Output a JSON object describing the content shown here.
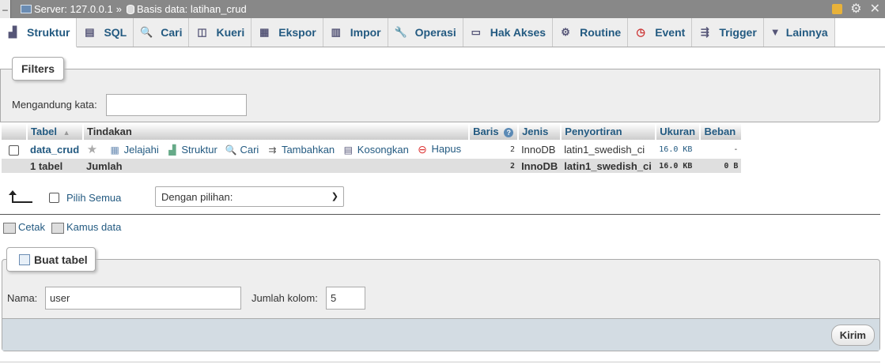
{
  "topbar": {
    "server_label": "Server: 127.0.0.1",
    "separator": "»",
    "db_label": "Basis data: latihan_crud",
    "collapse_glyph": "–"
  },
  "tabs": [
    {
      "label": "Struktur",
      "icon": "structure-icon",
      "active": true
    },
    {
      "label": "SQL",
      "icon": "sql-icon"
    },
    {
      "label": "Cari",
      "icon": "search-icon"
    },
    {
      "label": "Kueri",
      "icon": "query-icon"
    },
    {
      "label": "Ekspor",
      "icon": "export-icon"
    },
    {
      "label": "Impor",
      "icon": "import-icon"
    },
    {
      "label": "Operasi",
      "icon": "wrench-icon"
    },
    {
      "label": "Hak Akses",
      "icon": "privileges-icon"
    },
    {
      "label": "Routine",
      "icon": "routine-icon"
    },
    {
      "label": "Event",
      "icon": "event-icon"
    },
    {
      "label": "Trigger",
      "icon": "trigger-icon"
    },
    {
      "label": "Lainnya",
      "icon": "caret-down-icon"
    }
  ],
  "filters": {
    "legend": "Filters",
    "label": "Mengandung kata:",
    "value": ""
  },
  "table": {
    "headers": {
      "tabel": "Tabel",
      "tindakan": "Tindakan",
      "baris": "Baris",
      "jenis": "Jenis",
      "penyortiran": "Penyortiran",
      "ukuran": "Ukuran",
      "beban": "Beban"
    },
    "rows": [
      {
        "name": "data_crud",
        "actions": {
          "jelajahi": "Jelajahi",
          "struktur": "Struktur",
          "cari": "Cari",
          "tambahkan": "Tambahkan",
          "kosongkan": "Kosongkan",
          "hapus": "Hapus"
        },
        "baris": "2",
        "jenis": "InnoDB",
        "penyortiran": "latin1_swedish_ci",
        "ukuran": "16.0 KB",
        "beban": "-"
      }
    ],
    "summary": {
      "count": "1 tabel",
      "label": "Jumlah",
      "baris": "2",
      "jenis": "InnoDB",
      "penyortiran": "latin1_swedish_ci",
      "ukuran": "16.0 KB",
      "beban": "0 B"
    }
  },
  "with_selected": {
    "check_all_label": "Pilih Semua",
    "select_value": "Dengan pilihan:"
  },
  "print_links": {
    "cetak": "Cetak",
    "kamus": "Kamus data"
  },
  "create_table": {
    "legend": "Buat tabel",
    "name_label": "Nama:",
    "name_value": "user",
    "columns_label": "Jumlah kolom:",
    "columns_value": "5",
    "submit": "Kirim"
  }
}
